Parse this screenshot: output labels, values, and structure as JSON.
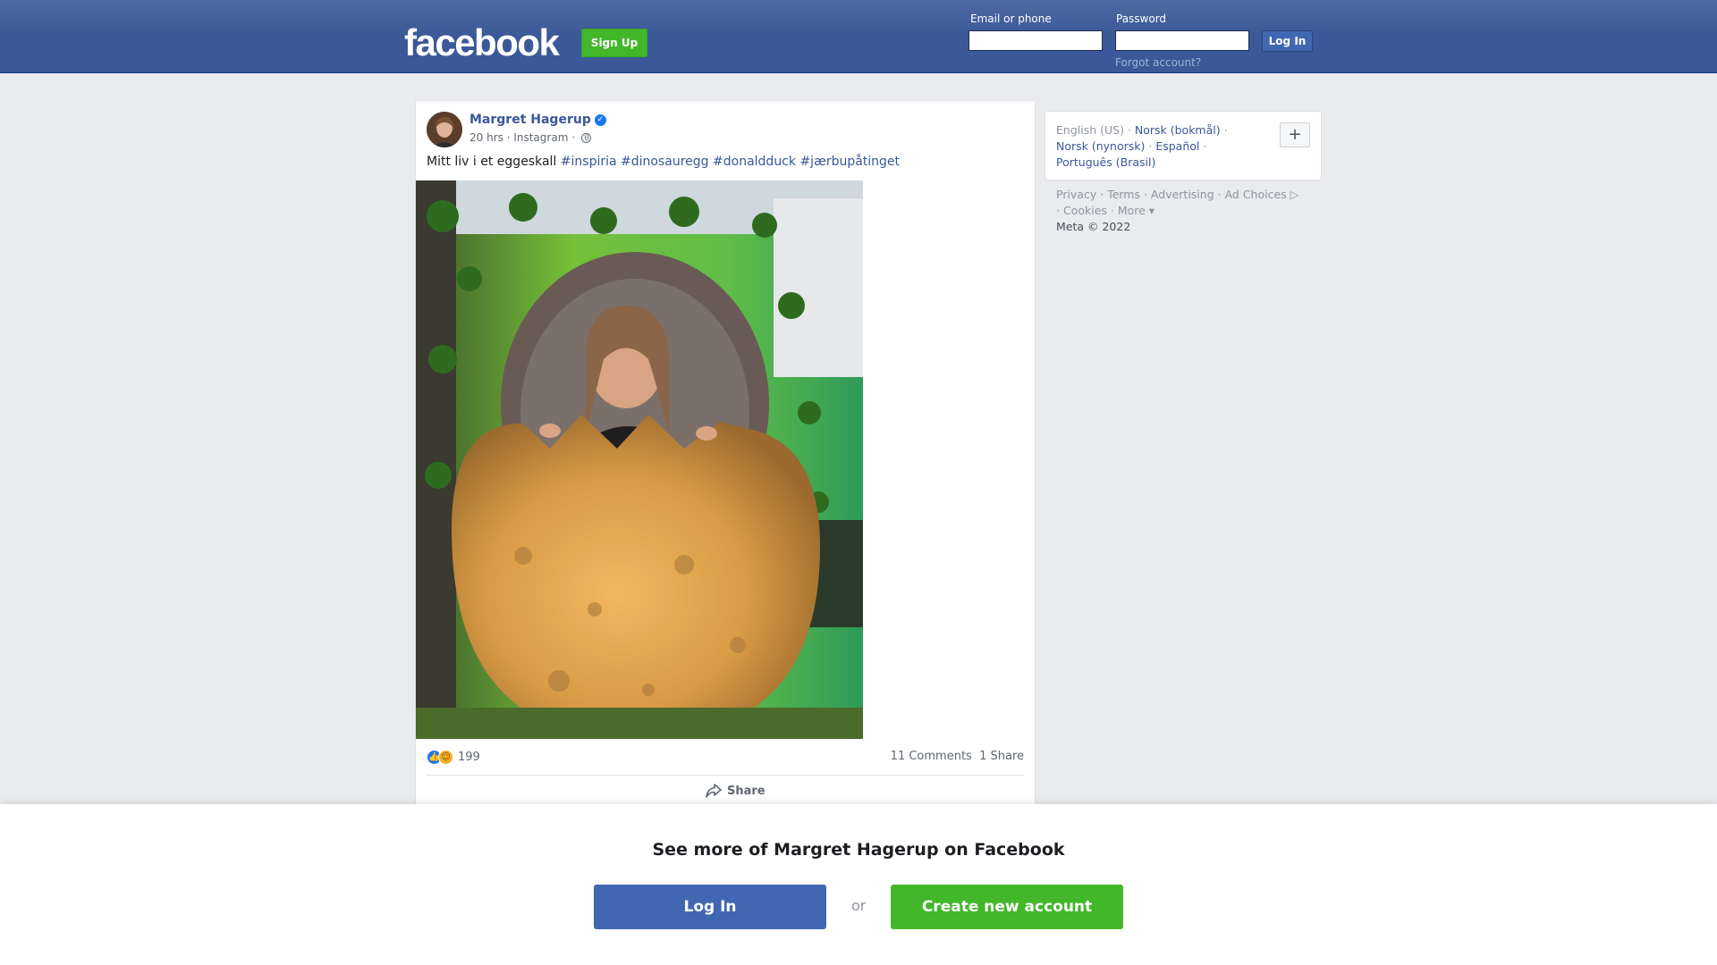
{
  "header": {
    "logo": "facebook",
    "signup_label": "Sign Up",
    "email_label": "Email or phone",
    "password_label": "Password",
    "login_label": "Log In",
    "forgot_label": "Forgot account?"
  },
  "post": {
    "author": "Margret Hagerup",
    "time": "20 hrs",
    "source": "Instagram",
    "caption_text": "Mitt liv i et eggeskall",
    "hashtags": [
      "#inspiria",
      "#dinosauregg",
      "#donaldduck",
      "#jærbupåtinget"
    ],
    "reaction_count": "199",
    "comments": "11 Comments",
    "shares": "1 Share",
    "share_button": "Share",
    "reaction_icons": [
      "like-icon",
      "haha-icon"
    ]
  },
  "sidebar": {
    "languages": [
      "English (US)",
      "Norsk (bokmål)",
      "Norsk (nynorsk)",
      "Español",
      "Português (Brasil)"
    ],
    "footer_links": [
      "Privacy",
      "Terms",
      "Advertising",
      "Ad Choices",
      "Cookies",
      "More"
    ],
    "copyright": "Meta © 2022"
  },
  "overlay": {
    "title": "See more of Margret Hagerup on Facebook",
    "login_label": "Log In",
    "or_label": "or",
    "create_label": "Create new account"
  },
  "colors": {
    "brand_blue": "#3b5998",
    "button_blue": "#4267b2",
    "green": "#42b72a",
    "link": "#385898"
  }
}
